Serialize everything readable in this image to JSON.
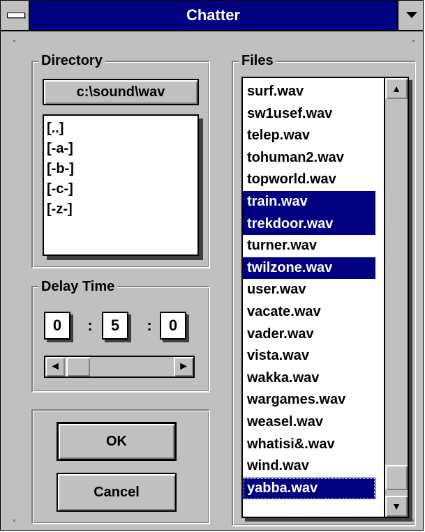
{
  "window": {
    "title": "Chatter"
  },
  "directory": {
    "label": "Directory",
    "path": "c:\\sound\\wav",
    "items": [
      "[..]",
      "[-a-]",
      "[-b-]",
      "[-c-]",
      "[-z-]"
    ]
  },
  "delay": {
    "label": "Delay Time",
    "hours": "0",
    "minutes": "5",
    "seconds": "0",
    "separator": ":",
    "left_arrow": "◄",
    "right_arrow": "►"
  },
  "buttons": {
    "ok": "OK",
    "cancel": "Cancel"
  },
  "files": {
    "label": "Files",
    "up_arrow": "▲",
    "down_arrow": "▼",
    "items": [
      {
        "name": "surf.wav",
        "selected": false
      },
      {
        "name": "sw1usef.wav",
        "selected": false
      },
      {
        "name": "telep.wav",
        "selected": false
      },
      {
        "name": "tohuman2.wav",
        "selected": false
      },
      {
        "name": "topworld.wav",
        "selected": false
      },
      {
        "name": "train.wav",
        "selected": true
      },
      {
        "name": "trekdoor.wav",
        "selected": true
      },
      {
        "name": "turner.wav",
        "selected": false
      },
      {
        "name": "twilzone.wav",
        "selected": true
      },
      {
        "name": "user.wav",
        "selected": false
      },
      {
        "name": "vacate.wav",
        "selected": false
      },
      {
        "name": "vader.wav",
        "selected": false
      },
      {
        "name": "vista.wav",
        "selected": false
      },
      {
        "name": "wakka.wav",
        "selected": false
      },
      {
        "name": "wargames.wav",
        "selected": false
      },
      {
        "name": "weasel.wav",
        "selected": false
      },
      {
        "name": "whatisi&.wav",
        "selected": false
      },
      {
        "name": "wind.wav",
        "selected": false
      },
      {
        "name": "yabba.wav",
        "selected": true
      }
    ]
  },
  "colors": {
    "titlebar": "#000080",
    "face": "#c0c0c0",
    "selection": "#000080"
  }
}
